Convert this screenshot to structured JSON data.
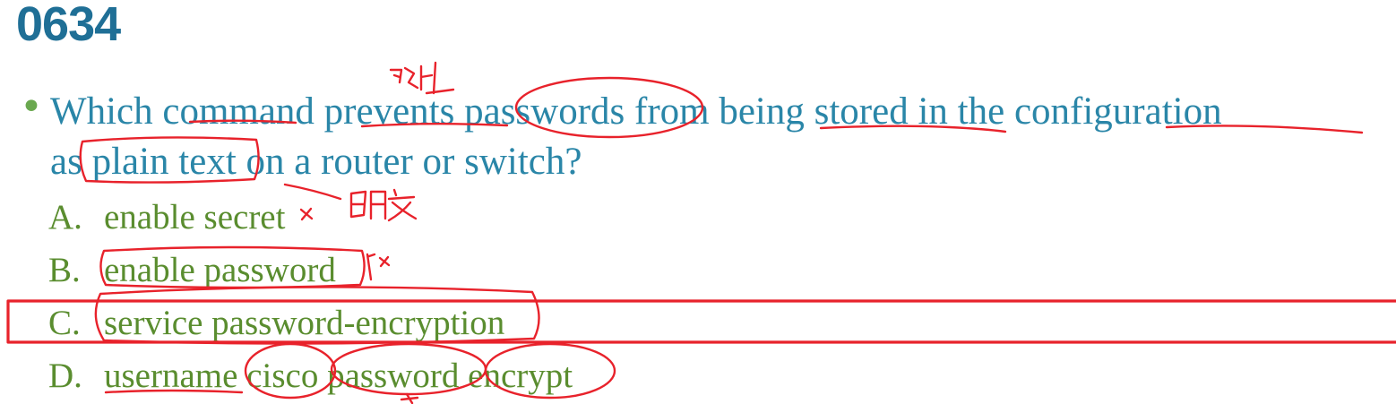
{
  "question_number": "0634",
  "bullet_glyph": "•",
  "question": {
    "line1": "Which command prevents passwords from being stored in the configuration",
    "line2": "as plain text on a router or switch?"
  },
  "options": [
    {
      "letter": "A.",
      "text": "enable secret"
    },
    {
      "letter": "B.",
      "text": "enable password"
    },
    {
      "letter": "C.",
      "text": "service password-encryption"
    },
    {
      "letter": "D.",
      "text": "username cisco password encrypt"
    }
  ],
  "highlighted_option": "C",
  "colors": {
    "title": "#1f6f96",
    "question": "#2a86a8",
    "options": "#5a8d2f",
    "bullet": "#6aa84f",
    "annotation": "#e8222b"
  }
}
